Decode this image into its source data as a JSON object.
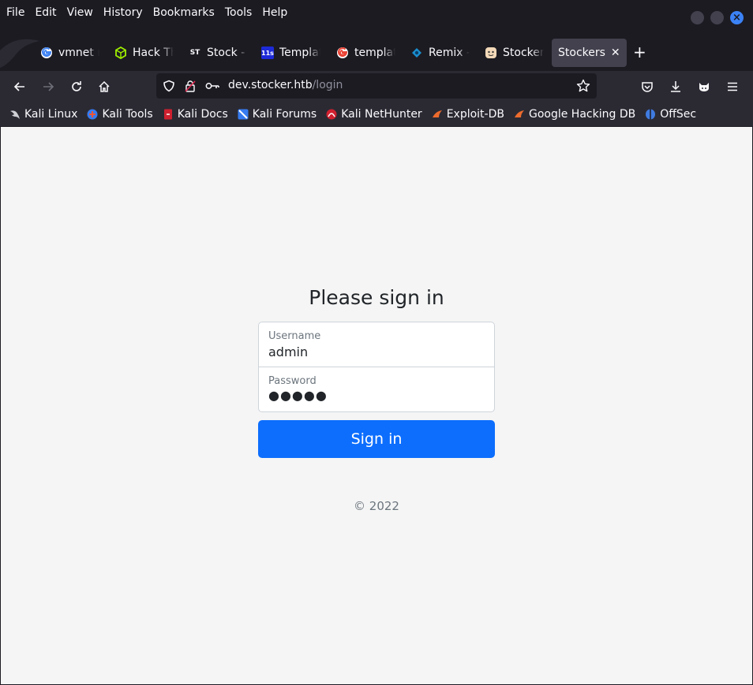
{
  "menu": [
    "File",
    "Edit",
    "View",
    "History",
    "Bookmarks",
    "Tools",
    "Help"
  ],
  "tabs": [
    {
      "label": "vmnet r",
      "icon": "google-icon"
    },
    {
      "label": "Hack Th",
      "icon": "hackthebox-icon"
    },
    {
      "label": "Stock - ",
      "icon": "st-icon",
      "icon_text": "ST"
    },
    {
      "label": "Templat",
      "icon": "11s-icon",
      "icon_text": "11s"
    },
    {
      "label": "templat",
      "icon": "google-icon"
    },
    {
      "label": "Remix - ",
      "icon": "remix-icon"
    },
    {
      "label": "Stocker",
      "icon": "stocker-icon"
    },
    {
      "label": "Stockers",
      "icon": "none",
      "active": true
    }
  ],
  "url": {
    "host": "dev.stocker.htb",
    "path": "/login"
  },
  "bookmarks": [
    "Kali Linux",
    "Kali Tools",
    "Kali Docs",
    "Kali Forums",
    "Kali NetHunter",
    "Exploit-DB",
    "Google Hacking DB",
    "OffSec"
  ],
  "login": {
    "heading": "Please sign in",
    "username_label": "Username",
    "username_value": "admin",
    "password_label": "Password",
    "password_value": "●●●●●",
    "submit_label": "Sign in",
    "copyright": "© 2022"
  },
  "colors": {
    "accent": "#0d6efd",
    "chrome_dark": "#1c1b22",
    "toolbar": "#2b2a33",
    "page_bg": "#f5f5f5"
  }
}
